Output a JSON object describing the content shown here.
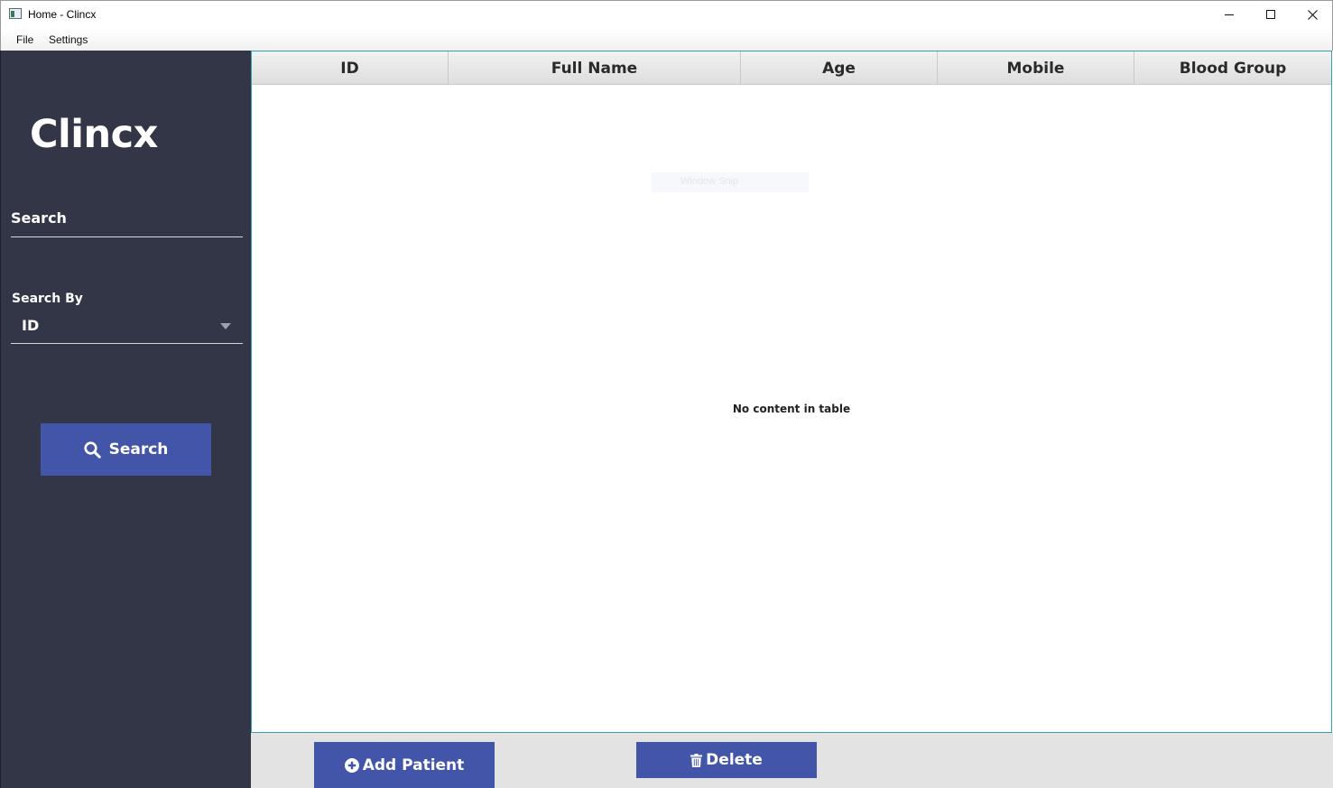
{
  "window": {
    "title": "Home - Clincx",
    "minimize_label": "minimize",
    "maximize_label": "maximize",
    "close_label": "close"
  },
  "menu": {
    "items": [
      {
        "label": "File"
      },
      {
        "label": "Settings"
      }
    ]
  },
  "sidebar": {
    "brand": "Clincx",
    "search_label": "Search",
    "search_value": "",
    "search_by_label": "Search By",
    "search_by_value": "ID",
    "search_button_label": "Search",
    "search_icon": "magnifier-icon"
  },
  "table": {
    "columns": [
      {
        "label": "ID"
      },
      {
        "label": "Full Name"
      },
      {
        "label": "Age"
      },
      {
        "label": "Mobile"
      },
      {
        "label": "Blood Group"
      }
    ],
    "rows": [],
    "empty_message": "No content in table",
    "overlay_text": "Window Snip"
  },
  "actions": {
    "add_label": "Add Patient",
    "add_icon": "plus-circle-icon",
    "delete_label": "Delete",
    "delete_icon": "trash-icon"
  },
  "colors": {
    "sidebar_bg": "#323647",
    "accent": "#4355a8",
    "table_border": "#3a9fb0",
    "bottom_bar": "#e3e3e3"
  }
}
